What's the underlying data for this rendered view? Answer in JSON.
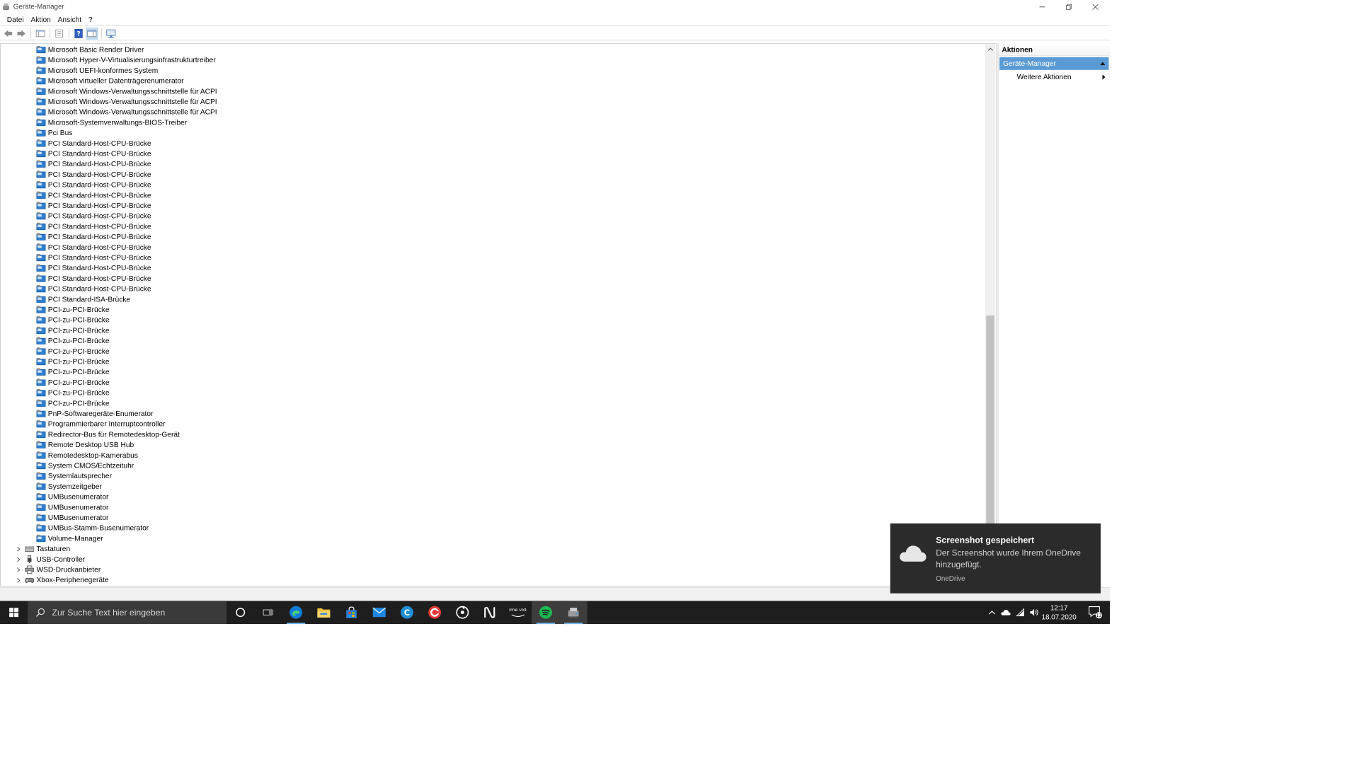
{
  "window": {
    "title": "Geräte-Manager"
  },
  "menu": [
    "Datei",
    "Aktion",
    "Ansicht",
    "?"
  ],
  "tree": {
    "children": [
      "Microsoft Basic Render Driver",
      "Microsoft Hyper-V-Virtualisierungsinfrastrukturtreiber",
      "Microsoft UEFI-konformes System",
      "Microsoft virtueller Datenträgerenumerator",
      "Microsoft Windows-Verwaltungsschnittstelle für ACPI",
      "Microsoft Windows-Verwaltungsschnittstelle für ACPI",
      "Microsoft Windows-Verwaltungsschnittstelle für ACPI",
      "Microsoft-Systemverwaltungs-BIOS-Treiber",
      "Pci Bus",
      "PCI Standard-Host-CPU-Brücke",
      "PCI Standard-Host-CPU-Brücke",
      "PCI Standard-Host-CPU-Brücke",
      "PCI Standard-Host-CPU-Brücke",
      "PCI Standard-Host-CPU-Brücke",
      "PCI Standard-Host-CPU-Brücke",
      "PCI Standard-Host-CPU-Brücke",
      "PCI Standard-Host-CPU-Brücke",
      "PCI Standard-Host-CPU-Brücke",
      "PCI Standard-Host-CPU-Brücke",
      "PCI Standard-Host-CPU-Brücke",
      "PCI Standard-Host-CPU-Brücke",
      "PCI Standard-Host-CPU-Brücke",
      "PCI Standard-Host-CPU-Brücke",
      "PCI Standard-Host-CPU-Brücke",
      "PCI Standard-ISA-Brücke",
      "PCI-zu-PCI-Brücke",
      "PCI-zu-PCI-Brücke",
      "PCI-zu-PCI-Brücke",
      "PCI-zu-PCI-Brücke",
      "PCI-zu-PCI-Brücke",
      "PCI-zu-PCI-Brücke",
      "PCI-zu-PCI-Brücke",
      "PCI-zu-PCI-Brücke",
      "PCI-zu-PCI-Brücke",
      "PCI-zu-PCI-Brücke",
      "PnP-Softwaregeräte-Enumerator",
      "Programmierbarer Interruptcontroller",
      "Redirector-Bus für Remotedesktop-Gerät",
      "Remote Desktop USB Hub",
      "Remotedesktop-Kamerabus",
      "System CMOS/Echtzeituhr",
      "Systemlautsprecher",
      "Systemzeitgeber",
      "UMBusenumerator",
      "UMBusenumerator",
      "UMBusenumerator",
      "UMBus-Stamm-Busenumerator",
      "Volume-Manager"
    ],
    "categories": [
      {
        "label": "Tastaturen",
        "icon": "keyboard-icon"
      },
      {
        "label": "USB-Controller",
        "icon": "usb-icon"
      },
      {
        "label": "WSD-Druckanbieter",
        "icon": "printer-icon"
      },
      {
        "label": "Xbox-Peripheriegeräte",
        "icon": "gamepad-icon"
      }
    ]
  },
  "actions": {
    "header": "Aktionen",
    "section": "Geräte-Manager",
    "more": "Weitere Aktionen"
  },
  "toast": {
    "title": "Screenshot gespeichert",
    "body": "Der Screenshot wurde Ihrem OneDrive hinzugefügt.",
    "source": "OneDrive"
  },
  "taskbar": {
    "search_placeholder": "Zur Suche Text hier eingeben",
    "apps": [
      "cortana-icon",
      "task-view-icon",
      "edge-icon",
      "file-explorer-icon",
      "store-icon",
      "mail-icon",
      "ccleaner-icon",
      "antivirus-icon",
      "music-app-icon",
      "notion-icon",
      "prime-video-icon",
      "spotify-icon",
      "device-manager-icon"
    ],
    "prime_label": "prime video",
    "time": "12:17",
    "date": "18.07.2020",
    "notifications": "13"
  },
  "colors": {
    "accent": "#5b9bd5",
    "taskbar": "#1e1e1e",
    "toast": "#2b2b2b",
    "spotify": "#1db954"
  }
}
